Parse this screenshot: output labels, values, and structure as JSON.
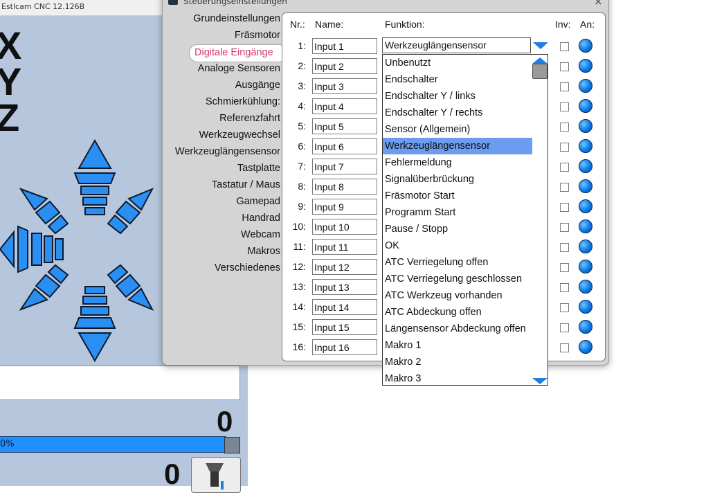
{
  "main_window": {
    "title": "Estlcam CNC 12.126B",
    "axes": [
      "X",
      "Y",
      "Z"
    ],
    "readout_top": "0",
    "readout_bottom": "0",
    "progress_text": "0%"
  },
  "dialog": {
    "title": "Steuerungseinstellungen",
    "close": "×",
    "nav_items": [
      "Grundeinstellungen",
      "Fräsmotor",
      "Digitale Eingänge",
      "Analoge Sensoren",
      "Ausgänge",
      "Schmierkühlung:",
      "Referenzfahrt",
      "Werkzeugwechsel",
      "Werkzeuglängensensor",
      "Tastplatte",
      "Tastatur / Maus",
      "Gamepad",
      "Handrad",
      "Webcam",
      "Makros",
      "Verschiedenes"
    ],
    "active_nav": "Digitale Eingänge",
    "headers": {
      "nr": "Nr.:",
      "name": "Name:",
      "funktion": "Funktion:",
      "inv": "Inv:",
      "an": "An:"
    },
    "rows": [
      {
        "nr": "1:",
        "name": "Input 1"
      },
      {
        "nr": "2:",
        "name": "Input 2"
      },
      {
        "nr": "3:",
        "name": "Input 3"
      },
      {
        "nr": "4:",
        "name": "Input 4"
      },
      {
        "nr": "5:",
        "name": "Input 5"
      },
      {
        "nr": "6:",
        "name": "Input 6"
      },
      {
        "nr": "7:",
        "name": "Input 7"
      },
      {
        "nr": "8:",
        "name": "Input 8"
      },
      {
        "nr": "9:",
        "name": "Input 9"
      },
      {
        "nr": "10:",
        "name": "Input 10"
      },
      {
        "nr": "11:",
        "name": "Input 11"
      },
      {
        "nr": "12:",
        "name": "Input 12"
      },
      {
        "nr": "13:",
        "name": "Input 13"
      },
      {
        "nr": "14:",
        "name": "Input 14"
      },
      {
        "nr": "15:",
        "name": "Input 15"
      },
      {
        "nr": "16:",
        "name": "Input 16"
      }
    ],
    "function_select": {
      "value": "Werkzeuglängensensor",
      "options": [
        "Unbenutzt",
        "Endschalter",
        "Endschalter Y / links",
        "Endschalter Y / rechts",
        "Sensor (Allgemein)",
        "Werkzeuglängensensor",
        "Fehlermeldung",
        "Signalüberbrückung",
        "Fräsmotor Start",
        "Programm Start",
        "Pause / Stopp",
        "OK",
        "ATC Verriegelung offen",
        "ATC Verriegelung geschlossen",
        "ATC Werkzeug vorhanden",
        "ATC Abdeckung offen",
        "Längensensor Abdeckung offen",
        "Makro 1",
        "Makro 2",
        "Makro 3"
      ],
      "selected_index": 5
    }
  },
  "colors": {
    "accent_blue": "#1e7fe0",
    "selection": "#6b9cf0",
    "active_nav_text": "#d23a6a",
    "bg_window": "#b5c6dd"
  }
}
